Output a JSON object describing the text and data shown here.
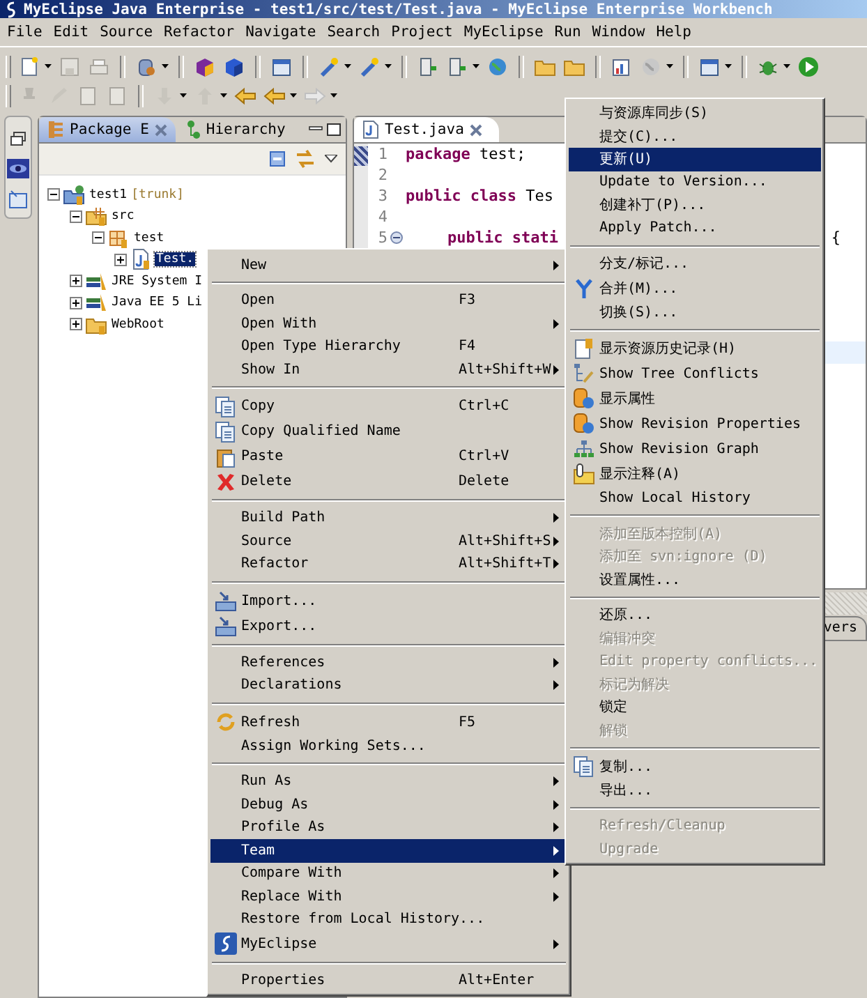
{
  "window": {
    "title": "MyEclipse Java Enterprise - test1/src/test/Test.java - MyEclipse Enterprise Workbench"
  },
  "menu_bar": [
    "File",
    "Edit",
    "Source",
    "Refactor",
    "Navigate",
    "Search",
    "Project",
    "MyEclipse",
    "Run",
    "Window",
    "Help"
  ],
  "package_explorer": {
    "tabs": [
      {
        "label": "Package E",
        "selected": true
      },
      {
        "label": "Hierarchy",
        "selected": false
      }
    ],
    "tree": [
      {
        "label": "test1",
        "tag": "[trunk]",
        "expanded": true,
        "children": [
          {
            "label": "src",
            "expanded": true,
            "children": [
              {
                "label": "test",
                "expanded": true,
                "children": [
                  {
                    "label": "Test.",
                    "selected": true,
                    "expanded": false
                  }
                ]
              }
            ]
          },
          {
            "label": "JRE System I",
            "selected": false,
            "expanded": false
          },
          {
            "label": "Java EE 5 Li",
            "selected": false,
            "expanded": false
          },
          {
            "label": "WebRoot",
            "selected": false,
            "expanded": false
          }
        ]
      }
    ]
  },
  "editor": {
    "tabs": [
      {
        "label": "Test.java",
        "selected": true
      }
    ],
    "current_line_highlight": true,
    "lines": [
      {
        "number": "1",
        "indented": false,
        "tokens": [
          {
            "text": "package",
            "kind": "keyword"
          },
          {
            "text": " test;",
            "kind": "plain"
          }
        ]
      },
      {
        "number": "2",
        "indented": false
      },
      {
        "number": "3",
        "indented": false,
        "tokens": [
          {
            "text": "public class",
            "kind": "keyword"
          },
          {
            "text": " Tes",
            "kind": "plain"
          }
        ]
      },
      {
        "number": "4",
        "indented": false
      },
      {
        "number": "5",
        "indented": true,
        "tokens": [
          {
            "text": "public stati",
            "kind": "keyword"
          }
        ],
        "tail": "{"
      }
    ]
  },
  "bottom_panel": {
    "tabs": [
      {
        "label": "vers"
      }
    ]
  },
  "context_menu": {
    "groups": [
      {
        "items": [
          {
            "label": "New",
            "submenu": true,
            "selected": false
          }
        ]
      },
      {
        "items": [
          {
            "label": "Open",
            "shortcut": "F3",
            "submenu": false,
            "selected": false
          },
          {
            "label": "Open With",
            "submenu": true,
            "selected": false
          },
          {
            "label": "Open Type Hierarchy",
            "shortcut": "F4",
            "submenu": false,
            "selected": false
          },
          {
            "label": "Show In",
            "shortcut": "Alt+Shift+W",
            "submenu": true,
            "selected": false
          }
        ]
      },
      {
        "items": [
          {
            "label": "Copy",
            "shortcut": "Ctrl+C",
            "submenu": false,
            "selected": false
          },
          {
            "label": "Copy Qualified Name",
            "submenu": false,
            "selected": false
          },
          {
            "label": "Paste",
            "shortcut": "Ctrl+V",
            "submenu": false,
            "selected": false
          },
          {
            "label": "Delete",
            "shortcut": "Delete",
            "submenu": false,
            "selected": false
          }
        ]
      },
      {
        "items": [
          {
            "label": "Build Path",
            "submenu": true,
            "selected": false
          },
          {
            "label": "Source",
            "shortcut": "Alt+Shift+S",
            "submenu": true,
            "selected": false
          },
          {
            "label": "Refactor",
            "shortcut": "Alt+Shift+T",
            "submenu": true,
            "selected": false
          }
        ]
      },
      {
        "items": [
          {
            "label": "Import...",
            "submenu": false,
            "selected": false
          },
          {
            "label": "Export...",
            "submenu": false,
            "selected": false
          }
        ]
      },
      {
        "items": [
          {
            "label": "References",
            "submenu": true,
            "selected": false
          },
          {
            "label": "Declarations",
            "submenu": true,
            "selected": false
          }
        ]
      },
      {
        "items": [
          {
            "label": "Refresh",
            "shortcut": "F5",
            "submenu": false,
            "selected": false
          },
          {
            "label": "Assign Working Sets...",
            "submenu": false,
            "selected": false
          }
        ]
      },
      {
        "items": [
          {
            "label": "Run As",
            "submenu": true,
            "selected": false
          },
          {
            "label": "Debug As",
            "submenu": true,
            "selected": false
          },
          {
            "label": "Profile As",
            "submenu": true,
            "selected": false
          },
          {
            "label": "Team",
            "submenu": true,
            "selected": true
          },
          {
            "label": "Compare With",
            "submenu": true,
            "selected": false
          },
          {
            "label": "Replace With",
            "submenu": true,
            "selected": false
          },
          {
            "label": "Restore from Local History...",
            "submenu": false,
            "selected": false
          },
          {
            "label": "MyEclipse",
            "submenu": true,
            "selected": false
          }
        ]
      },
      {
        "items": [
          {
            "label": "Properties",
            "shortcut": "Alt+Enter",
            "submenu": false,
            "selected": false
          }
        ]
      }
    ]
  },
  "team_menu": {
    "groups": [
      {
        "items": [
          {
            "label": "与资源库同步(S)",
            "selected": false,
            "disabled": false
          },
          {
            "label": "提交(C)...",
            "selected": false,
            "disabled": false
          },
          {
            "label": "更新(U)",
            "selected": true,
            "disabled": false
          },
          {
            "label": "Update to Version...",
            "selected": false,
            "disabled": false
          },
          {
            "label": "创建补丁(P)...",
            "selected": false,
            "disabled": false
          },
          {
            "label": "Apply Patch...",
            "selected": false,
            "disabled": false
          }
        ]
      },
      {
        "items": [
          {
            "label": "分支/标记...",
            "selected": false,
            "disabled": false
          },
          {
            "label": "合并(M)...",
            "selected": false,
            "disabled": false
          },
          {
            "label": "切换(S)...",
            "selected": false,
            "disabled": false
          }
        ]
      },
      {
        "items": [
          {
            "label": "显示资源历史记录(H)",
            "selected": false,
            "disabled": false
          },
          {
            "label": "Show Tree Conflicts",
            "selected": false,
            "disabled": false
          },
          {
            "label": "显示属性",
            "selected": false,
            "disabled": false
          },
          {
            "label": "Show Revision Properties",
            "selected": false,
            "disabled": false
          },
          {
            "label": "Show Revision Graph",
            "selected": false,
            "disabled": false
          },
          {
            "label": "显示注释(A)",
            "selected": false,
            "disabled": false
          },
          {
            "label": "Show Local History",
            "selected": false,
            "disabled": false
          }
        ]
      },
      {
        "items": [
          {
            "label": "添加至版本控制(A)",
            "selected": false,
            "disabled": true
          },
          {
            "label": "添加至 svn:ignore (D)",
            "selected": false,
            "disabled": true
          },
          {
            "label": "设置属性...",
            "selected": false,
            "disabled": false
          }
        ]
      },
      {
        "items": [
          {
            "label": "还原...",
            "selected": false,
            "disabled": false
          },
          {
            "label": "编辑冲突",
            "selected": false,
            "disabled": true
          },
          {
            "label": "Edit property conflicts...",
            "selected": false,
            "disabled": true
          },
          {
            "label": "标记为解决",
            "selected": false,
            "disabled": true
          },
          {
            "label": "锁定",
            "selected": false,
            "disabled": false
          },
          {
            "label": "解锁",
            "selected": false,
            "disabled": true
          }
        ]
      },
      {
        "items": [
          {
            "label": "复制...",
            "selected": false,
            "disabled": false
          },
          {
            "label": "导出...",
            "selected": false,
            "disabled": false
          }
        ]
      },
      {
        "items": [
          {
            "label": "Refresh/Cleanup",
            "selected": false,
            "disabled": true
          },
          {
            "label": "Upgrade",
            "selected": false,
            "disabled": true
          }
        ]
      }
    ]
  }
}
